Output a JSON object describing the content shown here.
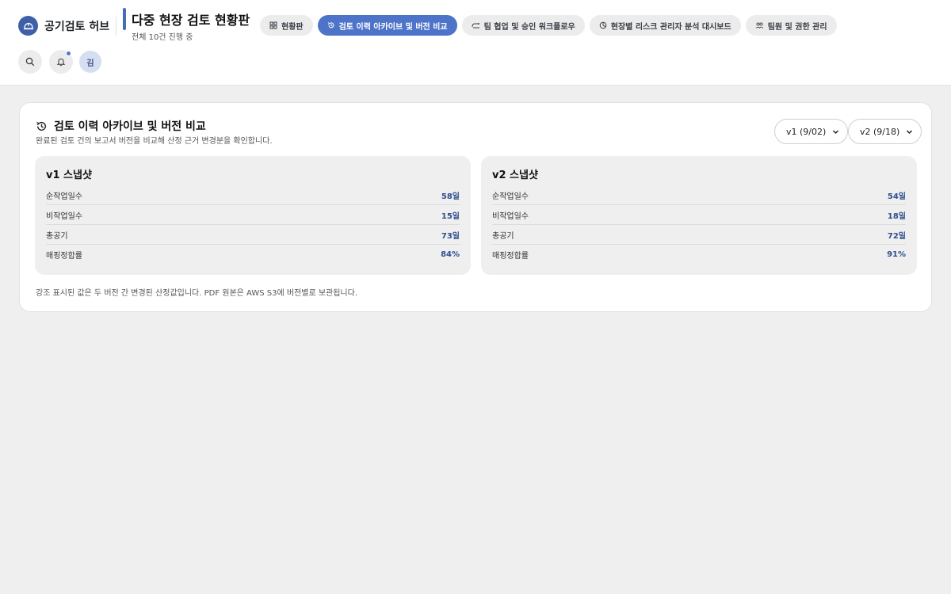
{
  "brand": {
    "name": "공기검토 허브",
    "logo_icon": "hardhat-icon"
  },
  "page": {
    "title": "다중 현장 검토 현황판",
    "subtitle": "전체 10건 진행 중"
  },
  "tabs": [
    {
      "label": "현황판",
      "icon": "dashboard-icon",
      "active": false
    },
    {
      "label": "검토 이력 아카이브 및 버전 비교",
      "icon": "history-icon",
      "active": true
    },
    {
      "label": "팀 협업 및 승인 워크플로우",
      "icon": "workflow-icon",
      "active": false
    },
    {
      "label": "현장별 리스크 관리자 분석 대시보드",
      "icon": "risk-icon",
      "active": false
    },
    {
      "label": "팀원 및 권한 관리",
      "icon": "team-icon",
      "active": false
    }
  ],
  "toolbar": {
    "search_icon": "search-icon",
    "bell_icon": "bell-icon",
    "avatar_initial": "김"
  },
  "archive": {
    "title": "검토 이력 아카이브 및 버전 비교",
    "description": "완료된 검토 건의 보고서 버전을 비교해 산정 근거 변경분을 확인합니다.",
    "select_a": "v1 (9/02)",
    "select_b": "v2 (9/18)",
    "snapshots": [
      {
        "title": "v1 스냅샷",
        "rows": [
          {
            "label": "순작업일수",
            "value": "58일"
          },
          {
            "label": "비작업일수",
            "value": "15일"
          },
          {
            "label": "총공기",
            "value": "73일"
          },
          {
            "label": "매핑정합률",
            "value": "84%"
          }
        ]
      },
      {
        "title": "v2 스냅샷",
        "rows": [
          {
            "label": "순작업일수",
            "value": "54일"
          },
          {
            "label": "비작업일수",
            "value": "18일"
          },
          {
            "label": "총공기",
            "value": "72일"
          },
          {
            "label": "매핑정합률",
            "value": "91%"
          }
        ]
      }
    ],
    "note": "강조 표시된 값은 두 버전 간 변경된 산정값입니다. PDF 원본은 AWS S3에 버전별로 보관됩니다."
  },
  "colors": {
    "accent": "#4e74c9",
    "value": "#2f4e8f",
    "brand": "#3f5fa8"
  }
}
